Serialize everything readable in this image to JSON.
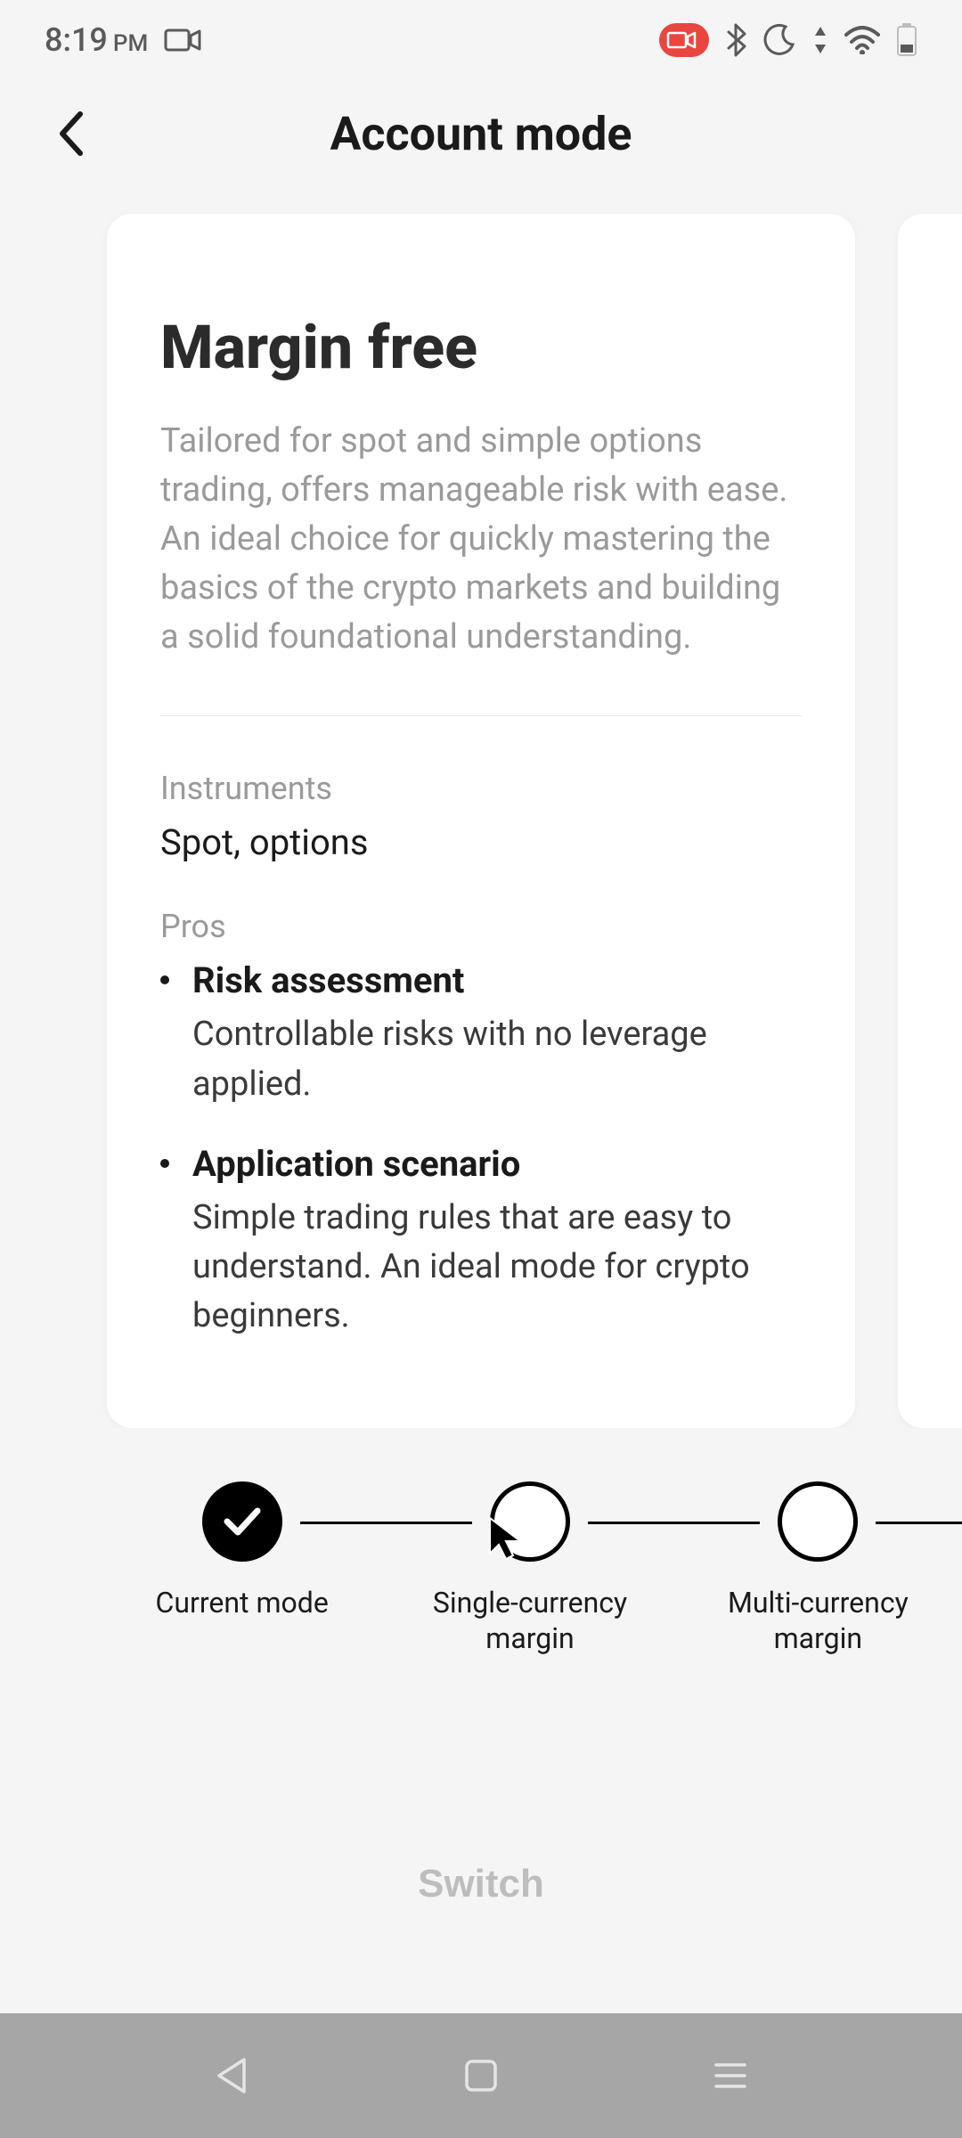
{
  "status": {
    "time": "8:19",
    "ampm": "PM"
  },
  "header": {
    "title": "Account mode"
  },
  "card": {
    "title": "Margin free",
    "description": "Tailored for spot and simple options trading, offers manageable risk with ease. An ideal choice for quickly mastering the basics of the crypto markets and building a solid foundational understanding.",
    "instruments_label": "Instruments",
    "instruments_value": "Spot, options",
    "pros_label": "Pros",
    "pros": [
      {
        "title": "Risk assessment",
        "desc": "Controllable risks with no leverage applied."
      },
      {
        "title": "Application scenario",
        "desc": "Simple trading rules that are easy to understand. An ideal mode for crypto beginners."
      }
    ]
  },
  "stepper": {
    "items": [
      {
        "label": "Current mode"
      },
      {
        "label": "Single-currency\nmargin"
      },
      {
        "label": "Multi-currency\nmargin"
      }
    ]
  },
  "switch_label": "Switch"
}
